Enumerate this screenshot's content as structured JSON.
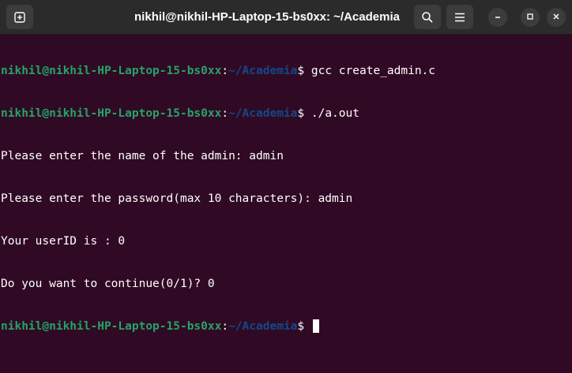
{
  "window": {
    "title": "nikhil@nikhil-HP-Laptop-15-bs0xx: ~/Academia"
  },
  "titlebar": {
    "new_tab_icon": "new-tab-icon",
    "search_icon": "search-icon",
    "menu_icon": "hamburger-menu-icon",
    "minimize_icon": "minimize-icon",
    "maximize_icon": "maximize-icon",
    "close_icon": "close-icon"
  },
  "prompt": {
    "user_host": "nikhil@nikhil-HP-Laptop-15-bs0xx",
    "separator": ":",
    "path": "~/Academia",
    "symbol": "$"
  },
  "terminal": {
    "lines": [
      {
        "type": "prompt",
        "command": " gcc create_admin.c"
      },
      {
        "type": "prompt",
        "command": " ./a.out"
      },
      {
        "type": "output",
        "text": "Please enter the name of the admin: admin"
      },
      {
        "type": "output",
        "text": "Please enter the password(max 10 characters): admin"
      },
      {
        "type": "output",
        "text": "Your userID is : 0"
      },
      {
        "type": "output",
        "text": "Do you want to continue(0/1)? 0"
      },
      {
        "type": "prompt",
        "command": " "
      }
    ]
  },
  "colors": {
    "background": "#300a24",
    "user_host": "#26a269",
    "path": "#12488b",
    "titlebar": "#2b2b2b"
  }
}
